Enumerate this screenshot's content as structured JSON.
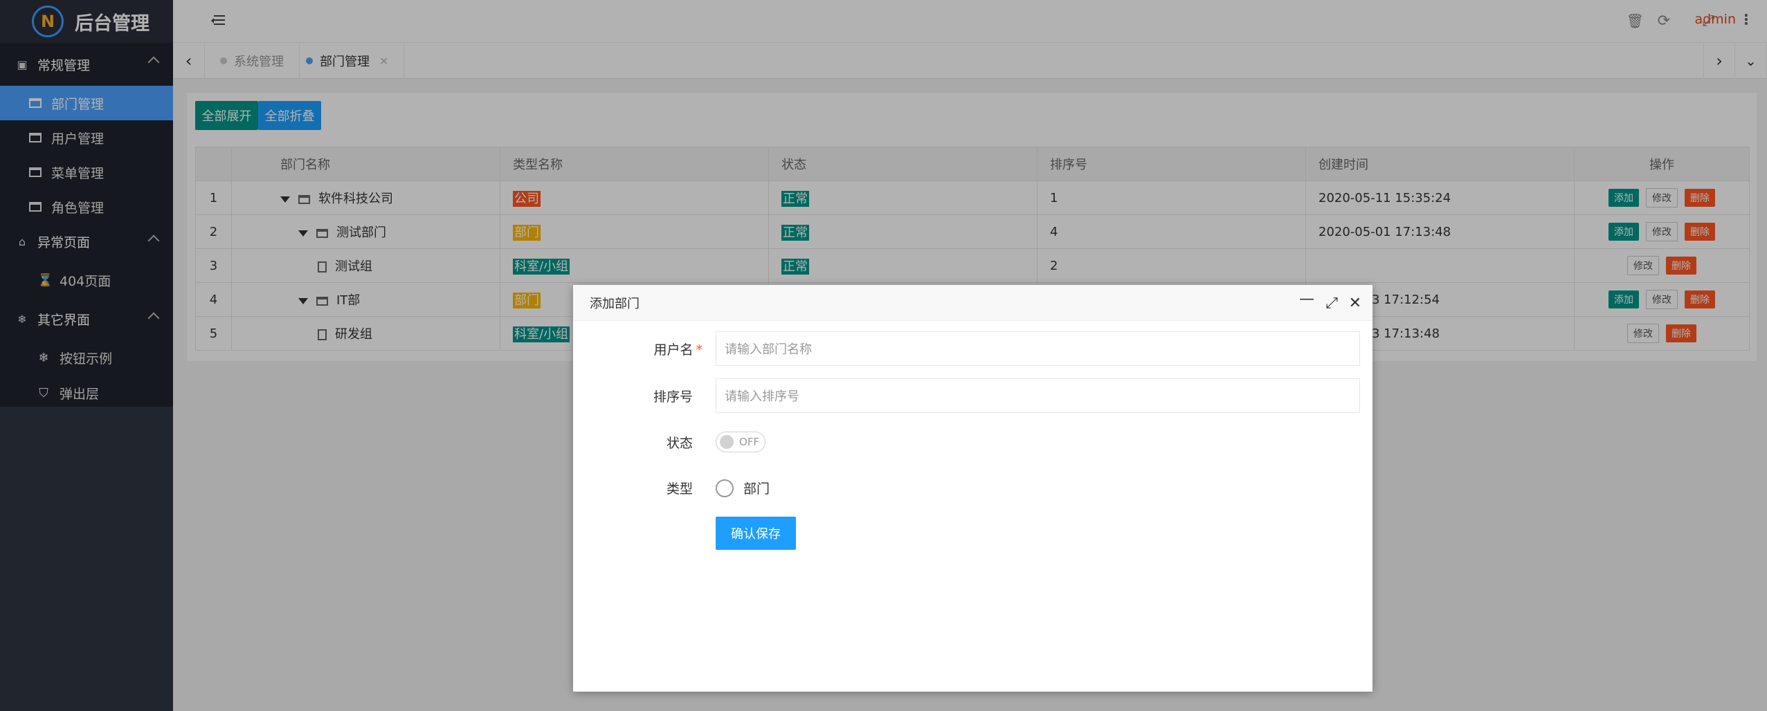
{
  "app": {
    "title": "后台管理",
    "logo_letter": "N"
  },
  "sidebar": {
    "groups": [
      {
        "label": "常规管理",
        "icon": "id-card-icon",
        "items": [
          "部门管理",
          "用户管理",
          "菜单管理",
          "角色管理"
        ]
      },
      {
        "label": "异常页面",
        "icon": "home-icon",
        "items": [
          "404页面"
        ]
      },
      {
        "label": "其它界面",
        "icon": "snowflake-icon",
        "items": [
          "按钮示例",
          "弹出层"
        ]
      }
    ],
    "active_item": "部门管理"
  },
  "topbar": {
    "user": "admin",
    "icons": [
      "refresh-icon",
      "trash-icon",
      "fullscreen-icon",
      "more-icon"
    ]
  },
  "tabs": [
    {
      "label": "系统管理",
      "active": false
    },
    {
      "label": "部门管理",
      "active": true
    }
  ],
  "toolbar": {
    "expand_all": "全部展开",
    "collapse_all": "全部折叠"
  },
  "table": {
    "headers": [
      "部门名称",
      "类型名称",
      "状态",
      "排序号",
      "创建时间",
      "操作"
    ],
    "rows": [
      {
        "num": "1",
        "name": "软件科技公司",
        "type": "公司",
        "type_color": "#ff5722",
        "status": "正常",
        "sort": "1",
        "time": "2020-05-11 15:35:24",
        "level": 0,
        "node": "folder-open"
      },
      {
        "num": "2",
        "name": "测试部门",
        "type": "部门",
        "type_color": "#ffb800",
        "status": "正常",
        "sort": "4",
        "time": "2020-05-01 17:13:48",
        "level": 1,
        "node": "folder-open"
      },
      {
        "num": "3",
        "name": "测试组",
        "type": "科室/小组",
        "type_color": "#009688",
        "status": "正常",
        "sort": "2",
        "time": "",
        "level": 2,
        "node": "leaf"
      },
      {
        "num": "4",
        "name": "IT部",
        "type": "部门",
        "type_color": "#ffb800",
        "status": "",
        "sort": "",
        "time": "3 17:12:54",
        "level": 1,
        "node": "folder-open"
      },
      {
        "num": "5",
        "name": "研发组",
        "type": "科室/小组",
        "type_color": "#009688",
        "status": "",
        "sort": "",
        "time": "3 17:13:48",
        "level": 2,
        "node": "leaf"
      }
    ],
    "ops": {
      "add": "添加",
      "edit": "修改",
      "delete": "删除"
    }
  },
  "dialog": {
    "title": "添加部门",
    "fields": {
      "username_label": "用户名",
      "username_placeholder": "请输入部门名称",
      "sort_label": "排序号",
      "sort_placeholder": "请输入排序号",
      "status_label": "状态",
      "status_value": "OFF",
      "type_label": "类型",
      "type_option": "部门"
    },
    "submit": "确认保存"
  },
  "colors": {
    "accent": "#4da3ff",
    "danger": "#ff5722",
    "green": "#009688"
  }
}
